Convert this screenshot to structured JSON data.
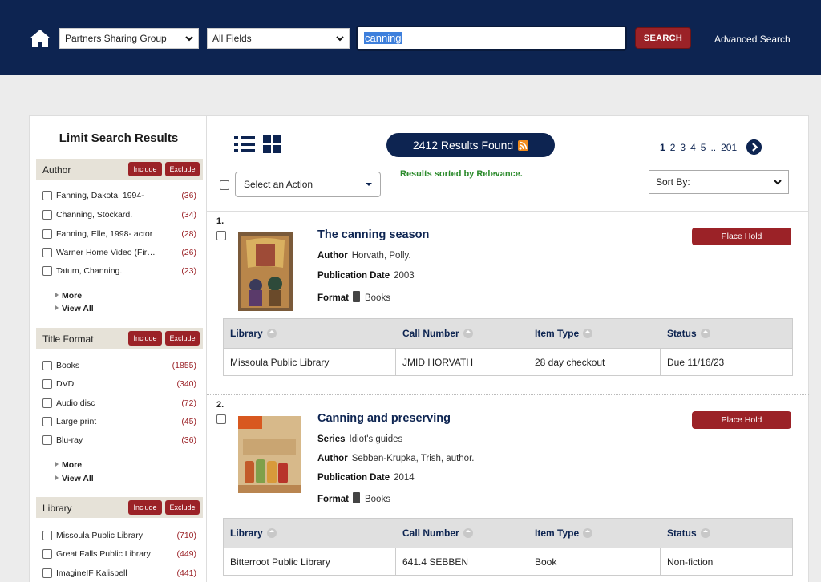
{
  "header": {
    "group_select": "Partners Sharing Group",
    "field_select": "All Fields",
    "search_value": "canning",
    "search_button": "SEARCH",
    "advanced_search": "Advanced Search"
  },
  "sidebar": {
    "title": "Limit Search Results",
    "include_label": "Include",
    "exclude_label": "Exclude",
    "more_label": "More",
    "view_all_label": "View All",
    "facets": [
      {
        "title": "Author",
        "items": [
          {
            "name": "Fanning, Dakota, 1994-",
            "count": "(36)"
          },
          {
            "name": "Channing, Stockard.",
            "count": "(34)"
          },
          {
            "name": "Fanning, Elle, 1998- actor",
            "count": "(28)"
          },
          {
            "name": "Warner Home Video (Fir…",
            "count": "(26)"
          },
          {
            "name": "Tatum, Channing.",
            "count": "(23)"
          }
        ]
      },
      {
        "title": "Title Format",
        "items": [
          {
            "name": "Books",
            "count": "(1855)"
          },
          {
            "name": "DVD",
            "count": "(340)"
          },
          {
            "name": "Audio disc",
            "count": "(72)"
          },
          {
            "name": "Large print",
            "count": "(45)"
          },
          {
            "name": "Blu-ray",
            "count": "(36)"
          }
        ]
      },
      {
        "title": "Library",
        "items": [
          {
            "name": "Missoula Public Library",
            "count": "(710)"
          },
          {
            "name": "Great Falls Public Library",
            "count": "(449)"
          },
          {
            "name": "ImagineIF Kalispell",
            "count": "(441)"
          }
        ]
      }
    ]
  },
  "results": {
    "found_label": "2412 Results Found",
    "sorted_note": "Results sorted by Relevance.",
    "action_select": "Select an Action",
    "sort_select": "Sort By:",
    "pages": [
      "1",
      "2",
      "3",
      "4",
      "5",
      "..",
      "201"
    ],
    "place_hold": "Place Hold",
    "table_headers": [
      "Library",
      "Call Number",
      "Item Type",
      "Status"
    ],
    "labels": {
      "author": "Author",
      "pub_date": "Publication Date",
      "format": "Format",
      "series": "Series"
    },
    "records": [
      {
        "num": "1.",
        "title": "The canning season",
        "author": "Horvath, Polly.",
        "pub_date": "2003",
        "format": "Books",
        "cover_title": "The Canning Season",
        "holding": [
          "Missoula Public Library",
          "JMID HORVATH",
          "28 day checkout",
          "Due 11/16/23"
        ]
      },
      {
        "num": "2.",
        "title": "Canning and preserving",
        "series": "Idiot's guides",
        "author": "Sebben-Krupka, Trish, author.",
        "pub_date": "2014",
        "format": "Books",
        "cover_title": "Canning & Preserving",
        "cover_badge": "IDIOT'S GUIDES",
        "holding": [
          "Bitterroot Public Library",
          "641.4 SEBBEN",
          "Book",
          "Non-fiction"
        ]
      }
    ]
  },
  "colors": {
    "navy": "#0d2451",
    "red": "#9b2227",
    "green": "#2a8a2a",
    "facet_bg": "#e6e2d8"
  }
}
